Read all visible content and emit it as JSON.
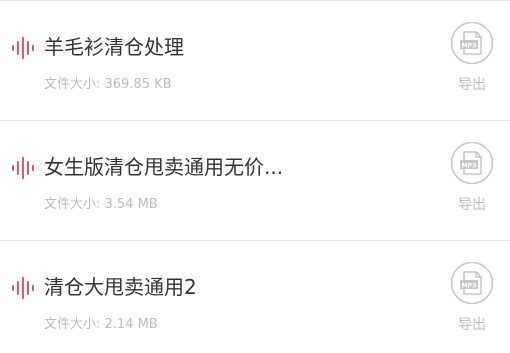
{
  "colors": {
    "wave_accent": "#e25b5b",
    "title_text": "#333333",
    "meta_text": "#bdbdbd",
    "icon_gray": "#c9c9c9",
    "divider": "#e6e6e6"
  },
  "recordings": [
    {
      "title": "羊毛衫清仓处理",
      "size_label": "文件大小: 369.85 KB",
      "file_icon_text": "MP3",
      "export_label": "导出",
      "wave_icon": "audio-wave-icon",
      "file_icon": "mp3-file-icon"
    },
    {
      "title": "女生版清仓甩卖通用无价...",
      "size_label": "文件大小: 3.54 MB",
      "file_icon_text": "MP3",
      "export_label": "导出",
      "wave_icon": "audio-wave-icon",
      "file_icon": "mp3-file-icon"
    },
    {
      "title": "清仓大甩卖通用2",
      "size_label": "文件大小: 2.14 MB",
      "file_icon_text": "MP3",
      "export_label": "导出",
      "wave_icon": "audio-wave-icon",
      "file_icon": "mp3-file-icon"
    }
  ]
}
